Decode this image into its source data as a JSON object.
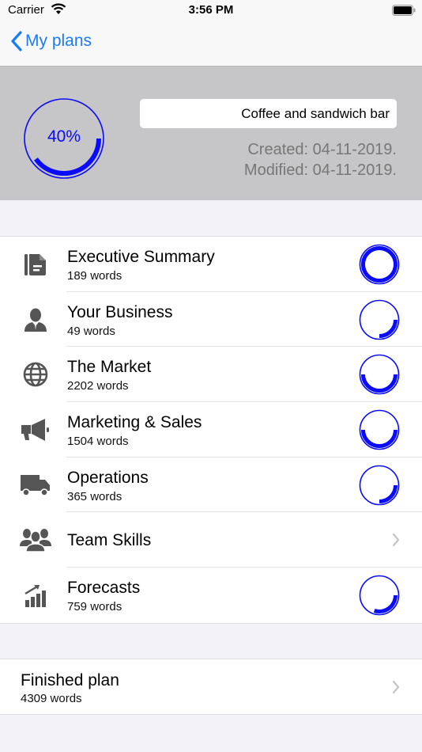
{
  "status_bar": {
    "carrier": "Carrier",
    "time": "3:56 PM"
  },
  "nav": {
    "back_label": "My plans"
  },
  "colors": {
    "accent": "#0a0aff",
    "link": "#1a7cf5",
    "header_bg": "#c6c6c8",
    "icon_gray": "#555555"
  },
  "plan": {
    "progress_percent": 40,
    "progress_label": "40%",
    "name": "Coffee and sandwich bar",
    "created": "Created: 04-11-2019.",
    "modified": "Modified: 04-11-2019."
  },
  "sections": [
    {
      "title": "Executive Summary",
      "words": "189 words",
      "icon": "document-icon",
      "progress": 1.0
    },
    {
      "title": "Your Business",
      "words": "49 words",
      "icon": "person-icon",
      "progress": 0.25
    },
    {
      "title": "The Market",
      "words": "2202 words",
      "icon": "globe-icon",
      "progress": 0.5
    },
    {
      "title": "Marketing & Sales",
      "words": "1504 words",
      "icon": "megaphone-icon",
      "progress": 0.5
    },
    {
      "title": "Operations",
      "words": "365 words",
      "icon": "truck-icon",
      "progress": 0.25
    },
    {
      "title": "Team Skills",
      "words": null,
      "icon": "team-icon",
      "progress": null
    },
    {
      "title": "Forecasts",
      "words": "759 words",
      "icon": "chart-growth-icon",
      "progress": 0.3
    }
  ],
  "finished": {
    "title": "Finished plan",
    "words": "4309 words"
  }
}
